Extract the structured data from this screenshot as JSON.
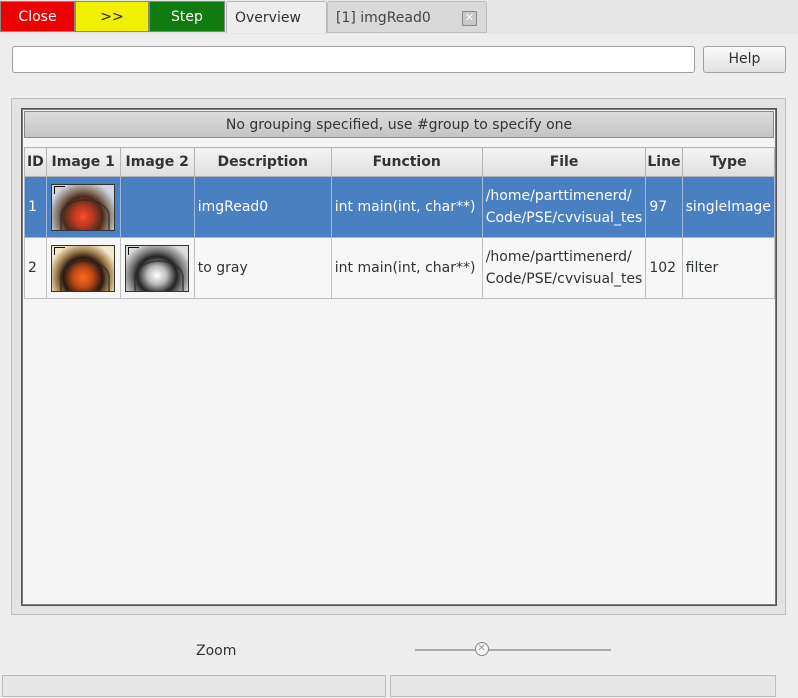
{
  "toolbar": {
    "close_label": "Close",
    "forward_label": ">>",
    "step_label": "Step"
  },
  "tabs": [
    {
      "label": "Overview",
      "active": true
    },
    {
      "label": "[1] imgRead0",
      "active": false,
      "close_icon": "close-icon"
    }
  ],
  "filter": {
    "value": "",
    "placeholder": ""
  },
  "help_label": "Help",
  "group_header": "No grouping specified, use #group to specify one",
  "columns": [
    "ID",
    "Image 1",
    "Image 2",
    "Description",
    "Function",
    "File",
    "Line",
    "Type"
  ],
  "rows": [
    {
      "id": "1",
      "image1": "typewriter-color-thumbnail",
      "image2": "",
      "description": "imgRead0",
      "function": "int main(int, char**)",
      "file_line1": "/home/parttimenerd/",
      "file_line2": "Code/PSE/cvvisual_tes",
      "line": "97",
      "type": "singleImage",
      "selected": true
    },
    {
      "id": "2",
      "image1": "typewriter-color-thumbnail",
      "image2": "typewriter-gray-thumbnail",
      "description": "to gray",
      "function": "int main(int, char**)",
      "file_line1": "/home/parttimenerd/",
      "file_line2": "Code/PSE/cvvisual_tes",
      "line": "102",
      "type": "filter",
      "selected": false
    }
  ],
  "zoom": {
    "label": "Zoom",
    "level": 0.34
  },
  "colors": {
    "close": "#ee0000",
    "forward": "#f0f000",
    "step": "#107c10",
    "selection": "#4a7fc1"
  }
}
